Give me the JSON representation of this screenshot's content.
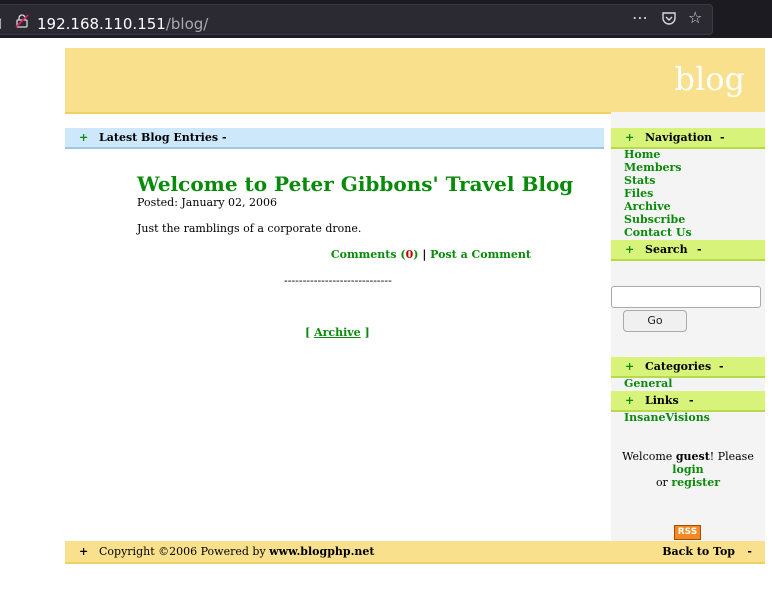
{
  "browser": {
    "url_host": "192.168.110.151",
    "url_path": "/blog/",
    "menu_icon": "⋯",
    "pocket_icon": "pocket-icon",
    "bookmark_icon": "☆"
  },
  "site": {
    "title": "blog"
  },
  "latest_bar": {
    "plus": "+",
    "label": "Latest Blog Entries",
    "minus": "-"
  },
  "post": {
    "title": "Welcome to Peter Gibbons' Travel Blog",
    "posted": "Posted: January 02, 2006",
    "body": "Just the ramblings of a corporate drone.",
    "comments_label": "Comments",
    "comments_open": "(",
    "comments_count": "0",
    "comments_close": ")",
    "separator": "|",
    "post_comment": "Post a Comment",
    "divider": "-----------------------------",
    "archive_open": "[",
    "archive": "Archive",
    "archive_close": "]"
  },
  "sidebar": {
    "navigation": {
      "plus": "+",
      "label": "Navigation",
      "minus": "-"
    },
    "nav_items": [
      "Home",
      "Members",
      "Stats",
      "Files",
      "Archive",
      "Subscribe",
      "Contact Us"
    ],
    "search": {
      "plus": "+",
      "label": "Search",
      "minus": "-",
      "button": "Go"
    },
    "categories": {
      "plus": "+",
      "label": "Categories",
      "minus": "-",
      "items": [
        "General"
      ]
    },
    "links": {
      "plus": "+",
      "label": "Links",
      "minus": "-",
      "items": [
        "InsaneVisions"
      ]
    },
    "welcome": {
      "prefix": "Welcome ",
      "user": "guest",
      "middle": "! Please ",
      "login": "login",
      "or": " or ",
      "register": "register"
    },
    "rss": "RSS"
  },
  "footer": {
    "plus": "+",
    "copyright": "Copyright ©2006 Powered by ",
    "powered": "www.blogphp.net",
    "back_to_top": "Back to Top",
    "minus": "-"
  },
  "colors": {
    "header": "#f8e08c",
    "latest_bar": "#cde8fb",
    "sidebar_bar": "#d8f37a",
    "link_green": "#0a8a0a",
    "count_red": "#c00000"
  }
}
